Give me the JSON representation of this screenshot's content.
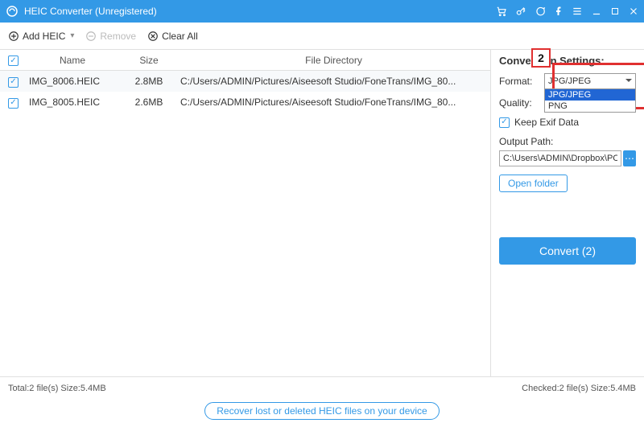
{
  "titlebar": {
    "title": "HEIC Converter (Unregistered)"
  },
  "toolbar": {
    "add_label": "Add HEIC",
    "remove_label": "Remove",
    "clear_label": "Clear All"
  },
  "table": {
    "headers": {
      "name": "Name",
      "size": "Size",
      "dir": "File Directory"
    },
    "rows": [
      {
        "checked": true,
        "name": "IMG_8006.HEIC",
        "size": "2.8MB",
        "dir": "C:/Users/ADMIN/Pictures/Aiseesoft Studio/FoneTrans/IMG_80..."
      },
      {
        "checked": true,
        "name": "IMG_8005.HEIC",
        "size": "2.6MB",
        "dir": "C:/Users/ADMIN/Pictures/Aiseesoft Studio/FoneTrans/IMG_80..."
      }
    ]
  },
  "settings": {
    "heading": "Conversion Settings:",
    "format_label": "Format:",
    "format_value": "JPG/JPEG",
    "format_options": [
      "JPG/JPEG",
      "PNG"
    ],
    "quality_label": "Quality:",
    "keep_exif_label": "Keep Exif Data",
    "output_path_label": "Output Path:",
    "output_path_value": "C:\\Users\\ADMIN\\Dropbox\\PC\\",
    "open_folder_label": "Open folder",
    "convert_label": "Convert (2)"
  },
  "status": {
    "left": "Total:2 file(s) Size:5.4MB",
    "right": "Checked:2 file(s) Size:5.4MB"
  },
  "bottom": {
    "link": "Recover lost or deleted HEIC files on your device"
  },
  "annotation": {
    "step": "2"
  }
}
